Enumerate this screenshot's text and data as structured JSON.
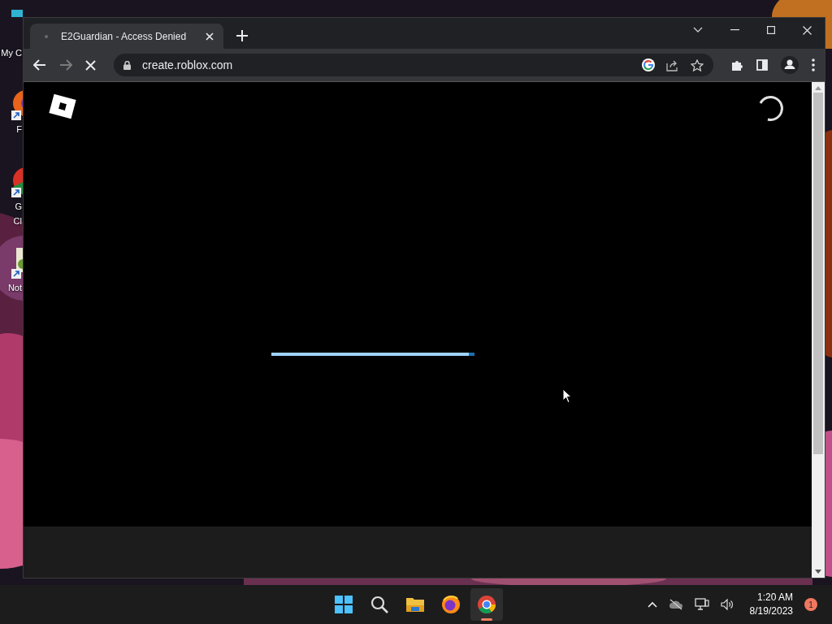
{
  "desktop": {
    "icons": [
      {
        "kind": "monitor",
        "lines": [
          "My C"
        ]
      },
      {
        "kind": "firefox",
        "lines": [
          "F"
        ]
      },
      {
        "kind": "chrome",
        "lines": [
          "G",
          "Cl"
        ]
      },
      {
        "kind": "notepad",
        "lines": [
          "Not"
        ]
      }
    ]
  },
  "browser": {
    "tabs": [
      {
        "title": "E2Guardian - Access Denied",
        "selected": true
      }
    ],
    "url": "create.roblox.com",
    "loading": true,
    "page": {
      "progress": {
        "level": 0.97
      }
    }
  },
  "taskbar": {
    "apps": [
      {
        "kind": "start",
        "selected": false
      },
      {
        "kind": "search",
        "selected": false
      },
      {
        "kind": "files",
        "selected": false
      },
      {
        "kind": "firefox",
        "selected": false
      },
      {
        "kind": "chrome",
        "selected": true
      }
    ],
    "time": "1:20 AM",
    "date": "8/19/2023",
    "badge": "1"
  }
}
